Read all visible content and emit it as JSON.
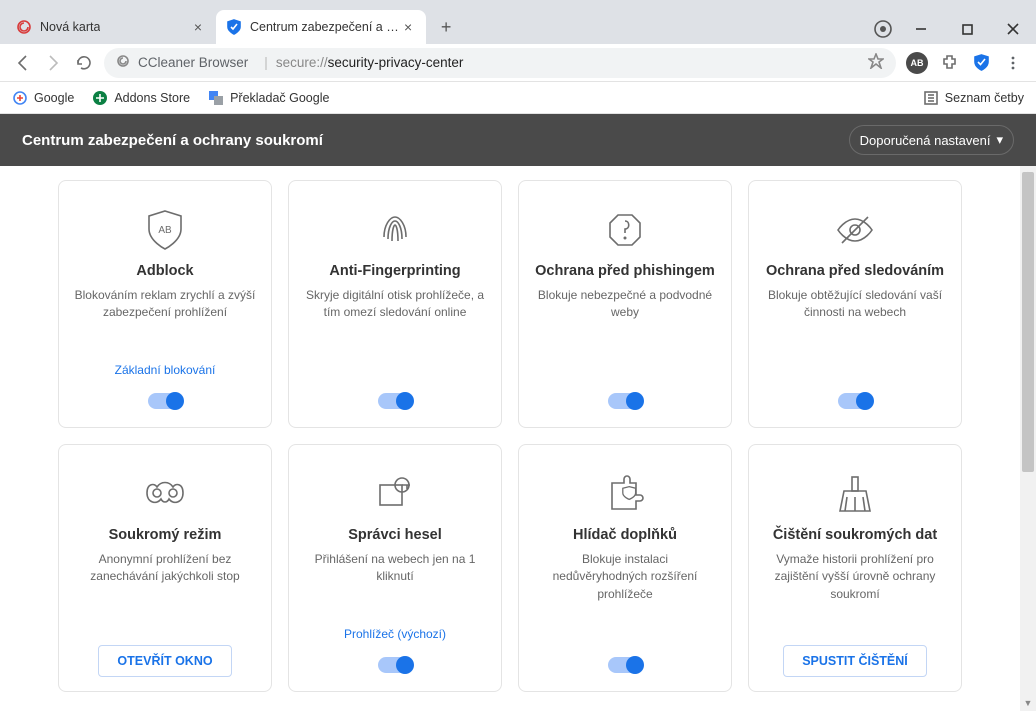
{
  "window": {
    "tabs": [
      {
        "label": "Nová karta"
      },
      {
        "label": "Centrum zabezpečení a ochrany"
      }
    ]
  },
  "address": {
    "brand": "CCleaner Browser",
    "url_prefix": "secure://",
    "url_path": "security-privacy-center"
  },
  "bookmarks": {
    "google": "Google",
    "addons": "Addons Store",
    "translator": "Překladač Google",
    "reading": "Seznam četby"
  },
  "page": {
    "title": "Centrum zabezpečení a ochrany soukromí",
    "settings_label": "Doporučená nastavení"
  },
  "cards": [
    {
      "title": "Adblock",
      "desc": "Blokováním reklam zrychlí a zvýší zabezpečení prohlížení",
      "note": "Základní blokování",
      "control": "toggle"
    },
    {
      "title": "Anti-Fingerprinting",
      "desc": "Skryje digitální otisk prohlížeče, a tím omezí sledování online",
      "note": "",
      "control": "toggle"
    },
    {
      "title": "Ochrana před phishingem",
      "desc": "Blokuje nebezpečné a podvodné weby",
      "note": "",
      "control": "toggle"
    },
    {
      "title": "Ochrana před sledováním",
      "desc": "Blokuje obtěžující sledování vaší činnosti na webech",
      "note": "",
      "control": "toggle"
    },
    {
      "title": "Soukromý režim",
      "desc": "Anonymní prohlížení bez zanechávání jakýchkoli stop",
      "note": "",
      "control": "button",
      "action": "OTEVŘÍT OKNO"
    },
    {
      "title": "Správci hesel",
      "desc": "Přihlášení na webech jen na 1 kliknutí",
      "note": "Prohlížeč (výchozí)",
      "control": "toggle"
    },
    {
      "title": "Hlídač doplňků",
      "desc": "Blokuje instalaci nedůvěryhodných rozšíření prohlížeče",
      "note": "",
      "control": "toggle"
    },
    {
      "title": "Čištění soukromých dat",
      "desc": "Vymaže historii prohlížení pro zajištění vyšší úrovně ochrany soukromí",
      "note": "",
      "control": "button",
      "action": "SPUSTIT ČIŠTĚNÍ"
    }
  ]
}
